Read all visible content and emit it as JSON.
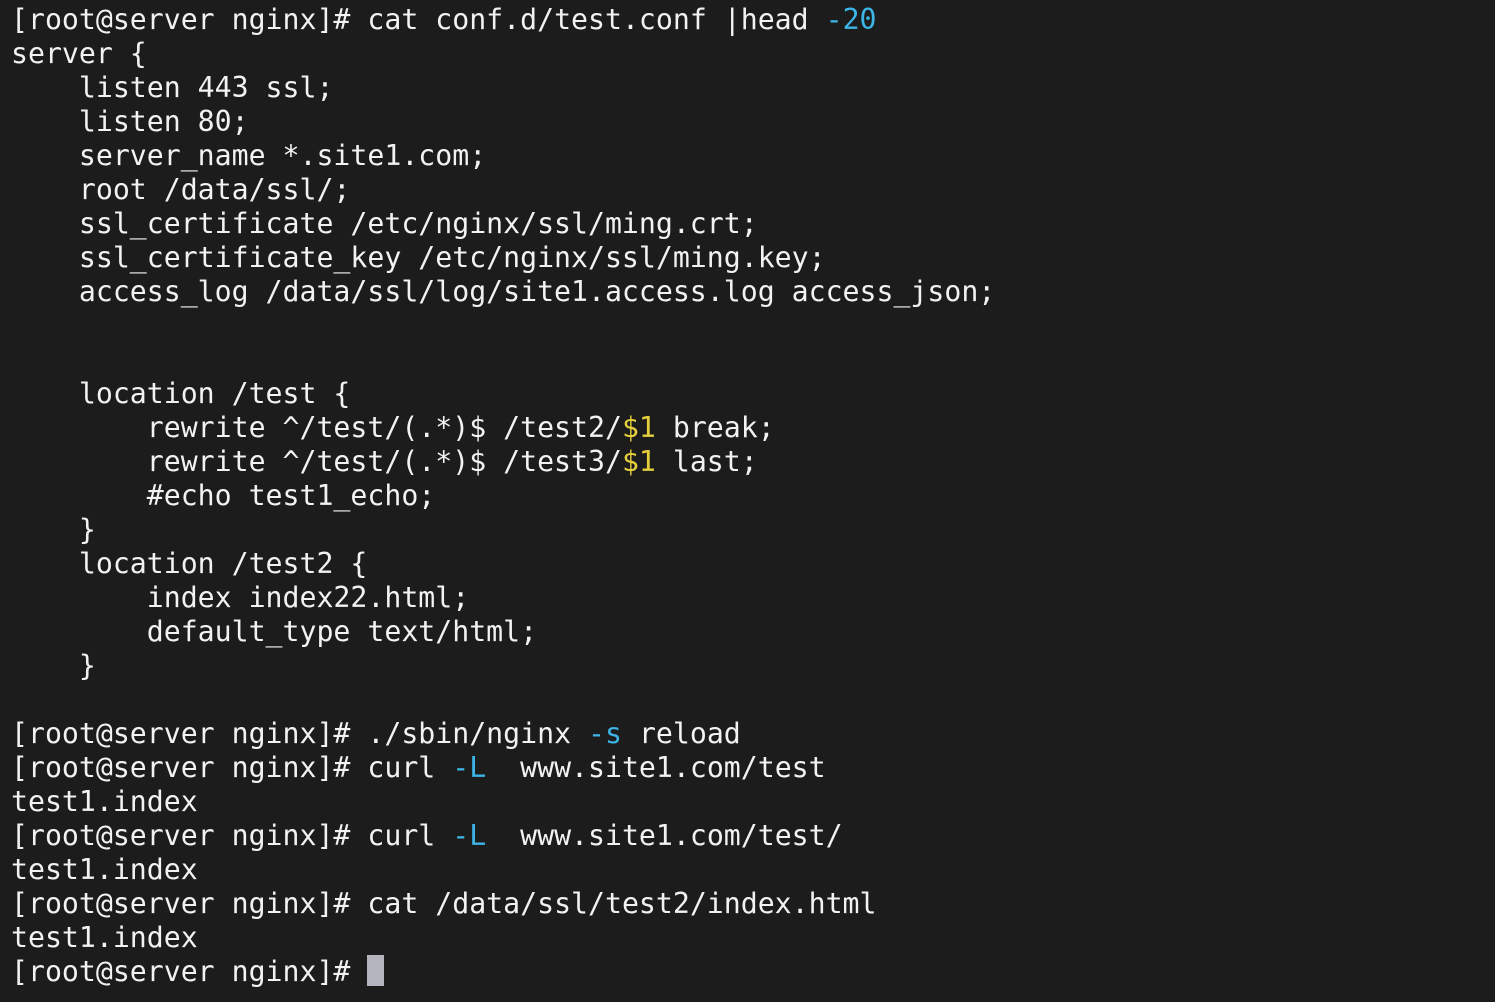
{
  "terminal": {
    "prompt": "[root@server nginx]# ",
    "colors": {
      "background": "#1c1c1c",
      "text": "#f2f2f2",
      "option": "#3cb4e6",
      "variable": "#e6cf3c",
      "cursor": "#b4b4be"
    },
    "lines": [
      {
        "prompt": true,
        "segments": [
          [
            "cat conf.d/test.conf |head ",
            ""
          ],
          [
            "-20",
            "cyan"
          ]
        ]
      },
      {
        "segments": [
          [
            "server {",
            ""
          ]
        ]
      },
      {
        "segments": [
          [
            "    listen 443 ssl;",
            ""
          ]
        ]
      },
      {
        "segments": [
          [
            "    listen 80;",
            ""
          ]
        ]
      },
      {
        "segments": [
          [
            "    server_name *.site1.com;",
            ""
          ]
        ]
      },
      {
        "segments": [
          [
            "    root /data/ssl/;",
            ""
          ]
        ]
      },
      {
        "segments": [
          [
            "    ssl_certificate /etc/nginx/ssl/ming.crt;",
            ""
          ]
        ]
      },
      {
        "segments": [
          [
            "    ssl_certificate_key /etc/nginx/ssl/ming.key;",
            ""
          ]
        ]
      },
      {
        "segments": [
          [
            "    access_log /data/ssl/log/site1.access.log access_json;",
            ""
          ]
        ]
      },
      {
        "segments": []
      },
      {
        "segments": []
      },
      {
        "segments": [
          [
            "    location /test {",
            ""
          ]
        ]
      },
      {
        "segments": [
          [
            "        rewrite ^/test/(.*)$ /test2/",
            ""
          ],
          [
            "$1",
            "yellow"
          ],
          [
            " break;",
            ""
          ]
        ]
      },
      {
        "segments": [
          [
            "        rewrite ^/test/(.*)$ /test3/",
            ""
          ],
          [
            "$1",
            "yellow"
          ],
          [
            " last;",
            ""
          ]
        ]
      },
      {
        "segments": [
          [
            "        #echo test1_echo;",
            ""
          ]
        ]
      },
      {
        "segments": [
          [
            "    }",
            ""
          ]
        ]
      },
      {
        "segments": [
          [
            "    location /test2 {",
            ""
          ]
        ]
      },
      {
        "segments": [
          [
            "        index index22.html;",
            ""
          ]
        ]
      },
      {
        "segments": [
          [
            "        default_type text/html;",
            ""
          ]
        ]
      },
      {
        "segments": [
          [
            "    }",
            ""
          ]
        ]
      },
      {
        "segments": []
      },
      {
        "prompt": true,
        "segments": [
          [
            "./sbin/nginx ",
            ""
          ],
          [
            "-s",
            "cyan"
          ],
          [
            " reload",
            ""
          ]
        ]
      },
      {
        "prompt": true,
        "segments": [
          [
            "curl ",
            ""
          ],
          [
            "-L",
            "cyan"
          ],
          [
            "  www.site1.com/test",
            ""
          ]
        ]
      },
      {
        "segments": [
          [
            "test1.index",
            ""
          ]
        ]
      },
      {
        "prompt": true,
        "segments": [
          [
            "curl ",
            ""
          ],
          [
            "-L",
            "cyan"
          ],
          [
            "  www.site1.com/test/",
            ""
          ]
        ]
      },
      {
        "segments": [
          [
            "test1.index",
            ""
          ]
        ]
      },
      {
        "prompt": true,
        "segments": [
          [
            "cat /data/ssl/test2/index.html",
            ""
          ]
        ]
      },
      {
        "segments": [
          [
            "test1.index",
            ""
          ]
        ]
      },
      {
        "prompt": true,
        "cursor": true,
        "segments": []
      }
    ]
  }
}
